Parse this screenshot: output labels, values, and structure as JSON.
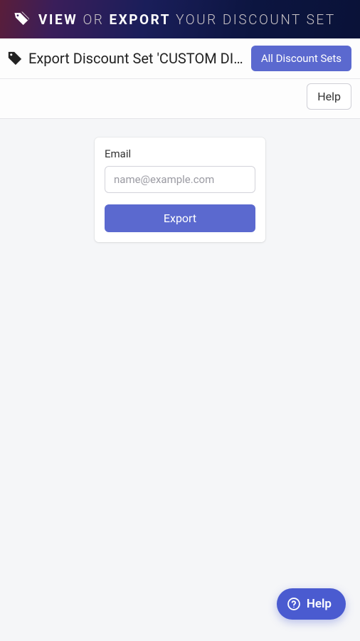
{
  "banner": {
    "word_view": "VIEW",
    "word_or": "OR",
    "word_export": "EXPORT",
    "word_tail": "YOUR DISCOUNT SET"
  },
  "header": {
    "title": "Export Discount Set 'CUSTOM DISCOUNT SET'",
    "all_sets_label": "All Discount Sets",
    "help_label": "Help"
  },
  "form": {
    "email_label": "Email",
    "email_placeholder": "name@example.com",
    "submit_label": "Export"
  },
  "fab": {
    "label": "Help"
  }
}
